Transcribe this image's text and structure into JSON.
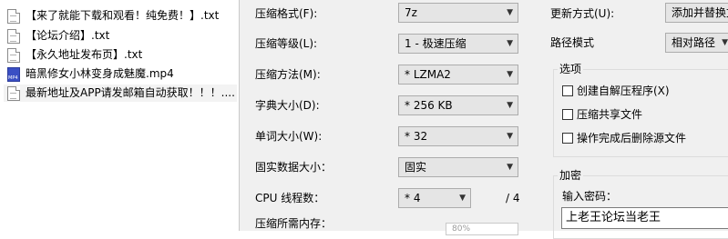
{
  "files": [
    {
      "name": "【来了就能下载和观看！纯免费！】.txt",
      "icon": "txt-file-icon"
    },
    {
      "name": "【论坛介绍】.txt",
      "icon": "txt-file-icon"
    },
    {
      "name": "【永久地址发布页】.txt",
      "icon": "txt-file-icon"
    },
    {
      "name": "暗黑修女小林变身成魅魔.mp4",
      "icon": "mp4-file-icon"
    },
    {
      "name": "最新地址及APP请发邮箱自动获取！！！....",
      "icon": "txt-file-icon"
    }
  ],
  "settings": {
    "format": {
      "label": "压缩格式(F):",
      "value": "7z"
    },
    "level": {
      "label": "压缩等级(L):",
      "value": "1 - 极速压缩"
    },
    "method": {
      "label": "压缩方法(M):",
      "value": "* LZMA2"
    },
    "dict": {
      "label": "字典大小(D):",
      "value": "* 256 KB"
    },
    "word": {
      "label": "单词大小(W):",
      "value": "* 32"
    },
    "solid": {
      "label": "固实数据大小：",
      "value": "固实"
    },
    "cpu": {
      "label": "CPU 线程数：",
      "value": "* 4",
      "total": "/ 4"
    },
    "memory": {
      "label": "压缩所需内存：",
      "value": "80%"
    }
  },
  "update": {
    "label": "更新方式(U):",
    "value": "添加并替换文"
  },
  "path": {
    "label": "路径模式",
    "value": "相对路径"
  },
  "options": {
    "title": "选项",
    "sfx": "创建自解压程序(X)",
    "shared": "压缩共享文件",
    "delete": "操作完成后删除源文件"
  },
  "encryption": {
    "title": "加密",
    "password_label": "输入密码：",
    "password_value": "上老王论坛当老王"
  }
}
